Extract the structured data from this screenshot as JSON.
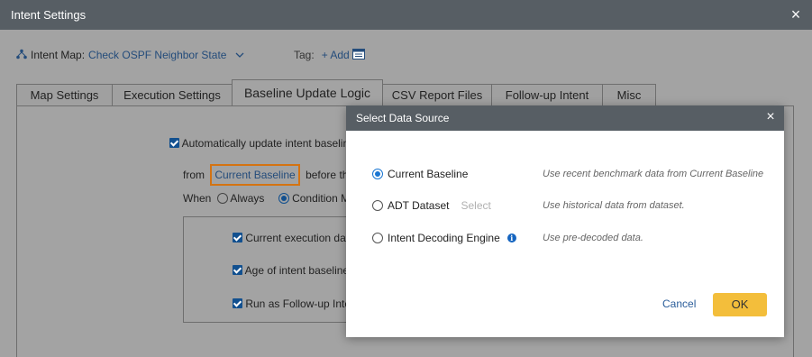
{
  "window": {
    "title": "Intent Settings"
  },
  "intent_map": {
    "label": "Intent Map:",
    "value": "Check OSPF Neighbor State"
  },
  "tag": {
    "label": "Tag:",
    "add_label": "+ Add"
  },
  "tabs": [
    {
      "label": "Map Settings",
      "active": false
    },
    {
      "label": "Execution Settings",
      "active": false
    },
    {
      "label": "Baseline Update Logic",
      "active": true
    },
    {
      "label": "CSV Report Files",
      "active": false
    },
    {
      "label": "Follow-up Intent",
      "active": false
    },
    {
      "label": "Misc",
      "active": false
    }
  ],
  "baseline": {
    "auto_update_label": "Automatically update intent baseline",
    "from_label": "from",
    "source_link": "Current Baseline",
    "before_label": "before the In",
    "when_label": "When",
    "always_label": "Always",
    "condition_label": "Condition M",
    "options": [
      {
        "label": "Current execution dat"
      },
      {
        "label": "Age of intent baseline"
      },
      {
        "label": "Run as Follow-up Inter"
      }
    ]
  },
  "modal": {
    "title": "Select Data Source",
    "options": [
      {
        "label": "Current Baseline",
        "desc": "Use recent benchmark data from Current Baseline",
        "selected": true
      },
      {
        "label": "ADT Dataset",
        "extra": "Select",
        "desc": "Use historical data from dataset.",
        "selected": false
      },
      {
        "label": "Intent Decoding Engine",
        "desc": "Use pre-decoded data.",
        "selected": false
      }
    ],
    "cancel_label": "Cancel",
    "ok_label": "OK"
  },
  "colors": {
    "accent": "#1976d2",
    "ok_button": "#f3be3b",
    "highlight": "#d47312",
    "header": "#575e64"
  }
}
